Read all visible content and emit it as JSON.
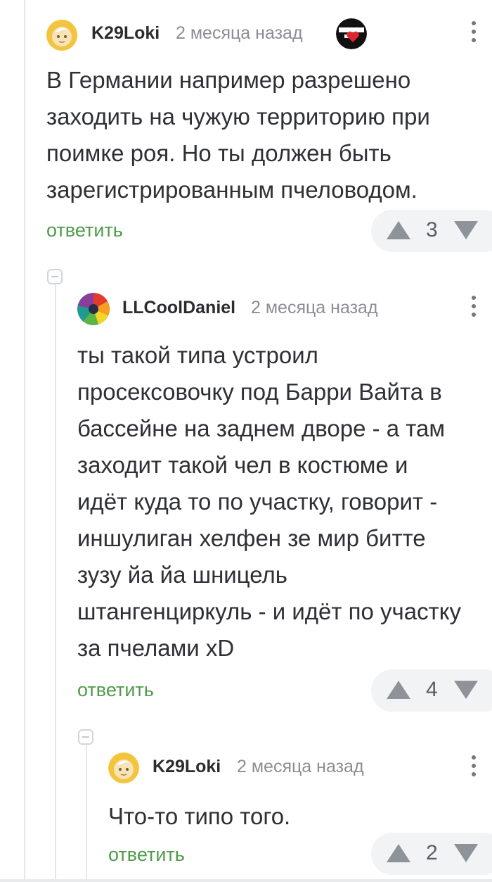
{
  "comments": [
    {
      "author": "K29Loki",
      "time": "2 месяца назад",
      "badge": "ghost-heart-badge",
      "body_lines": [
        "В Германии например разрешено",
        "заходить на чужую территорию при",
        "поимке роя. Но ты должен быть",
        "зарегистрированным пчеловодом."
      ],
      "reply_label": "ответить",
      "rating": "3"
    },
    {
      "author": "LLCoolDaniel",
      "time": "2 месяца назад",
      "body_lines": [
        "ты такой типа устроил",
        "просексовочку под Барри Вайта в",
        "бассейне на заднем дворе - а там",
        "заходит такой чел в костюме и",
        "идёт куда то по участку, говорит -",
        "иншулиган хелфен зе мир битте",
        "зузу йа йа шницель",
        "штангенциркуль - и идёт по участку",
        "за пчелами xD"
      ],
      "reply_label": "ответить",
      "rating": "4"
    },
    {
      "author": "K29Loki",
      "time": "2 месяца назад",
      "body_lines": [
        "Что-то типо того."
      ],
      "reply_label": "ответить",
      "rating": "2"
    }
  ],
  "colors": {
    "reply": "#4f9b4a",
    "vote_bg": "#f2f3f5",
    "arrow": "#8e9299"
  }
}
